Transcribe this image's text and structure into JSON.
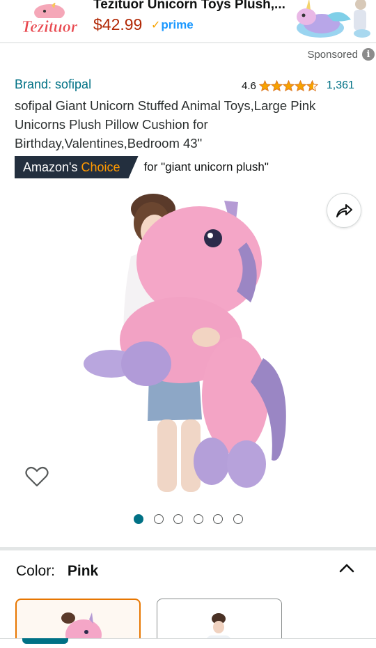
{
  "ad": {
    "logo_text": "Tezituor",
    "title": "Tezituor Unicorn Toys Plush,...",
    "price": "$42.99",
    "prime_label": "prime",
    "colors": {
      "price": "#b12704",
      "prime": "#1a98ff",
      "logo": "#e8484f"
    }
  },
  "sponsored": {
    "label": "Sponsored",
    "info_glyph": "i"
  },
  "product": {
    "brand": "Brand: sofipal",
    "rating_value": "4.6",
    "stars": 4.6,
    "rating_count": "1,361",
    "title": "sofipal Giant Unicorn Stuffed Animal Toys,Large Pink Unicorns Plush Pillow Cushion for Birthday,Valentines,Bedroom 43\"",
    "choice_badge_prefix": "Amazon's",
    "choice_badge_accent": "Choice",
    "choice_for": "for \"giant unicorn plush\""
  },
  "gallery": {
    "image_count": 6,
    "active_index": 0,
    "share_icon": "share-icon",
    "wishlist_icon": "heart-icon"
  },
  "variation": {
    "label": "Color:",
    "selected": "Pink",
    "expand_icon": "chevron-up-icon"
  },
  "theme": {
    "link": "#007185",
    "badge_bg": "#232f3e",
    "badge_accent": "#ff9900",
    "star": "#f7a300",
    "selected_border": "#e77600"
  }
}
